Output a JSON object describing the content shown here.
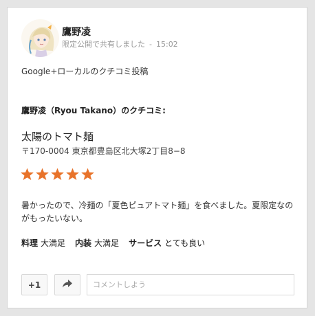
{
  "post": {
    "author": "鷹野凌",
    "visibility": "限定公開で共有しました",
    "separator": "-",
    "time": "15:02",
    "intro": "Google+ローカルのクチコミ投稿"
  },
  "review": {
    "reviewer_heading": "鷹野凌（Ryou Takano）のクチコミ:",
    "place_name": "太陽のトマト麺",
    "address": "〒170-0004 東京都豊島区北大塚2丁目8−8",
    "rating_stars": 5,
    "star_color": "#e8732a",
    "text": "暑かったので、冷麺の「夏色ピュアトマト麺」を食べました。夏限定なのがもったいない。",
    "ratings": [
      {
        "key": "料理",
        "value": "大満足"
      },
      {
        "key": "内装",
        "value": "大満足"
      },
      {
        "key": "サービス",
        "value": "とても良い"
      }
    ]
  },
  "actions": {
    "plus_one_label": "+1",
    "share_icon": "share-arrow-icon",
    "comment_placeholder": "コメントしよう"
  }
}
